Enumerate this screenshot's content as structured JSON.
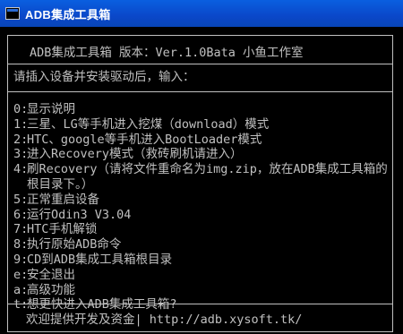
{
  "window": {
    "title": "ADB集成工具箱",
    "icon": "console-icon"
  },
  "header": {
    "title": "ADB集成工具箱 版本：Ver.1.0Bata 小鱼工作室"
  },
  "prompt": {
    "text": "请插入设备并安装驱动后，输入："
  },
  "menu": {
    "items": [
      {
        "key": "0:",
        "label": "显示说明"
      },
      {
        "key": "1:",
        "label": "三星、LG等手机进入挖煤（download）模式"
      },
      {
        "key": "2:",
        "label": "HTC、google等手机进入BootLoader模式"
      },
      {
        "key": "3:",
        "label": "进入Recovery模式（救砖刷机请进入）"
      },
      {
        "key": "4:",
        "label": "刷Recovery（请将文件重命名为img.zip，放在ADB集成工具箱的根目录下。）"
      },
      {
        "key": "5:",
        "label": "正常重启设备"
      },
      {
        "key": "6:",
        "label": "运行Odin3 V3.04"
      },
      {
        "key": "7:",
        "label": "HTC手机解锁"
      },
      {
        "key": "8:",
        "label": "执行原始ADB命令"
      },
      {
        "key": "9:",
        "label": "CD到ADB集成工具箱根目录"
      },
      {
        "key": "e:",
        "label": "安全退出"
      },
      {
        "key": "a:",
        "label": "高级功能"
      },
      {
        "key": "t:",
        "label": "想更快进入ADB集成工具箱?"
      }
    ]
  },
  "footer": {
    "text": "欢迎提供开发及资金| http://adb.xysoft.tk/"
  },
  "colors": {
    "titlebar": "#0a47c9",
    "console_bg": "#000000",
    "console_text": "#c0c0c0"
  }
}
